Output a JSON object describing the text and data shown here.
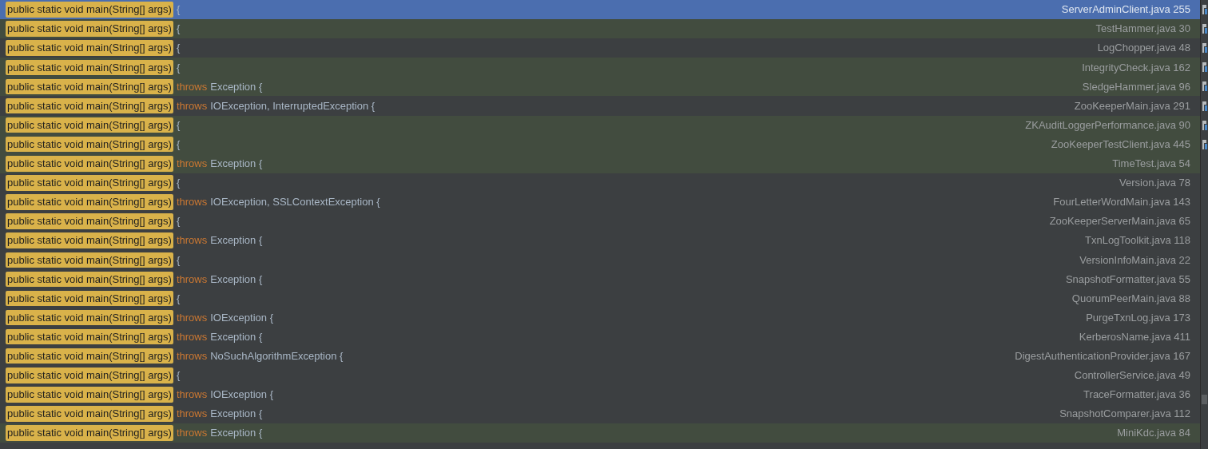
{
  "rows": [
    {
      "match": "public static void main(String[] args)",
      "tail": "{",
      "file": "ServerAdminClient.java 255",
      "selected": true,
      "modified": false,
      "marker": true
    },
    {
      "match": "public static void main(String[] args)",
      "tail": "{",
      "file": "TestHammer.java 30",
      "selected": false,
      "modified": true,
      "marker": true
    },
    {
      "match": "public static void main(String[] args)",
      "tail": "{",
      "file": "LogChopper.java 48",
      "selected": false,
      "modified": false,
      "marker": true
    },
    {
      "match": "public static void main(String[] args)",
      "tail": "{",
      "file": "IntegrityCheck.java 162",
      "selected": false,
      "modified": true,
      "marker": true
    },
    {
      "match": "public static void main(String[] args)",
      "keyword": "throws",
      "tail": "Exception {",
      "file": "SledgeHammer.java 96",
      "selected": false,
      "modified": true,
      "marker": true
    },
    {
      "match": "public static void main(String[] args)",
      "keyword": "throws",
      "tail": "IOException, InterruptedException {",
      "file": "ZooKeeperMain.java 291",
      "selected": false,
      "modified": false,
      "marker": true
    },
    {
      "match": "public static void main(String[] args)",
      "tail": "{",
      "file": "ZKAuditLoggerPerformance.java 90",
      "selected": false,
      "modified": true,
      "marker": true
    },
    {
      "match": "public static void main(String[] args)",
      "tail": "{",
      "file": "ZooKeeperTestClient.java 445",
      "selected": false,
      "modified": true,
      "marker": true
    },
    {
      "match": "public static void main(String[] args)",
      "keyword": "throws",
      "tail": "Exception {",
      "file": "TimeTest.java 54",
      "selected": false,
      "modified": true,
      "marker": false
    },
    {
      "match": "public static void main(String[] args)",
      "tail": "{",
      "file": "Version.java 78",
      "selected": false,
      "modified": false,
      "marker": false
    },
    {
      "match": "public static void main(String[] args)",
      "keyword": "throws",
      "tail": "IOException, SSLContextException {",
      "file": "FourLetterWordMain.java 143",
      "selected": false,
      "modified": false,
      "marker": false
    },
    {
      "match": "public static void main(String[] args)",
      "tail": "{",
      "file": "ZooKeeperServerMain.java 65",
      "selected": false,
      "modified": false,
      "marker": false
    },
    {
      "match": "public static void main(String[] args)",
      "keyword": "throws",
      "tail": "Exception {",
      "file": "TxnLogToolkit.java 118",
      "selected": false,
      "modified": false,
      "marker": false
    },
    {
      "match": "public static void main(String[] args)",
      "tail": "{",
      "file": "VersionInfoMain.java 22",
      "selected": false,
      "modified": false,
      "marker": false
    },
    {
      "match": "public static void main(String[] args)",
      "keyword": "throws",
      "tail": "Exception {",
      "file": "SnapshotFormatter.java 55",
      "selected": false,
      "modified": false,
      "marker": false
    },
    {
      "match": "public static void main(String[] args)",
      "tail": "{",
      "file": "QuorumPeerMain.java 88",
      "selected": false,
      "modified": false,
      "marker": false
    },
    {
      "match": "public static void main(String[] args)",
      "keyword": "throws",
      "tail": "IOException {",
      "file": "PurgeTxnLog.java 173",
      "selected": false,
      "modified": false,
      "marker": false
    },
    {
      "match": "public static void main(String[] args)",
      "keyword": "throws",
      "tail": "Exception {",
      "file": "KerberosName.java 411",
      "selected": false,
      "modified": false,
      "marker": false
    },
    {
      "match": "public static void main(String[] args)",
      "keyword": "throws",
      "tail": "NoSuchAlgorithmException {",
      "file": "DigestAuthenticationProvider.java 167",
      "selected": false,
      "modified": false,
      "marker": false
    },
    {
      "match": "public static void main(String[] args)",
      "tail": "{",
      "file": "ControllerService.java 49",
      "selected": false,
      "modified": false,
      "marker": false
    },
    {
      "match": "public static void main(String[] args)",
      "keyword": "throws",
      "tail": "IOException {",
      "file": "TraceFormatter.java 36",
      "selected": false,
      "modified": false,
      "marker": false
    },
    {
      "match": "public static void main(String[] args)",
      "keyword": "throws",
      "tail": "Exception {",
      "file": "SnapshotComparer.java 112",
      "selected": false,
      "modified": false,
      "marker": false
    },
    {
      "match": "public static void main(String[] args)",
      "keyword": "throws",
      "tail": "Exception {",
      "file": "MiniKdc.java 84",
      "selected": false,
      "modified": true,
      "marker": false
    }
  ]
}
